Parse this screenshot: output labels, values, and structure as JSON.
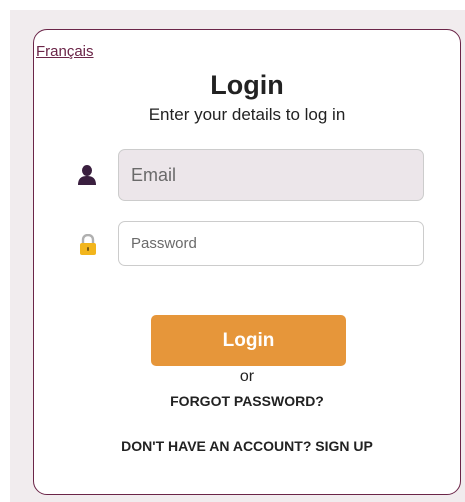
{
  "language_link": "Français",
  "title": "Login",
  "subtitle": "Enter your details to log in",
  "email": {
    "placeholder": "Email",
    "icon": "user-icon"
  },
  "password": {
    "placeholder": "Password",
    "icon": "lock-icon"
  },
  "login_button": "Login",
  "or_text": "or",
  "forgot_password": "FORGOT PASSWORD?",
  "signup": "DON'T HAVE AN ACCOUNT? SIGN UP",
  "colors": {
    "accent": "#e6963a",
    "brand": "#6b2548",
    "background": "#f1ecee"
  }
}
